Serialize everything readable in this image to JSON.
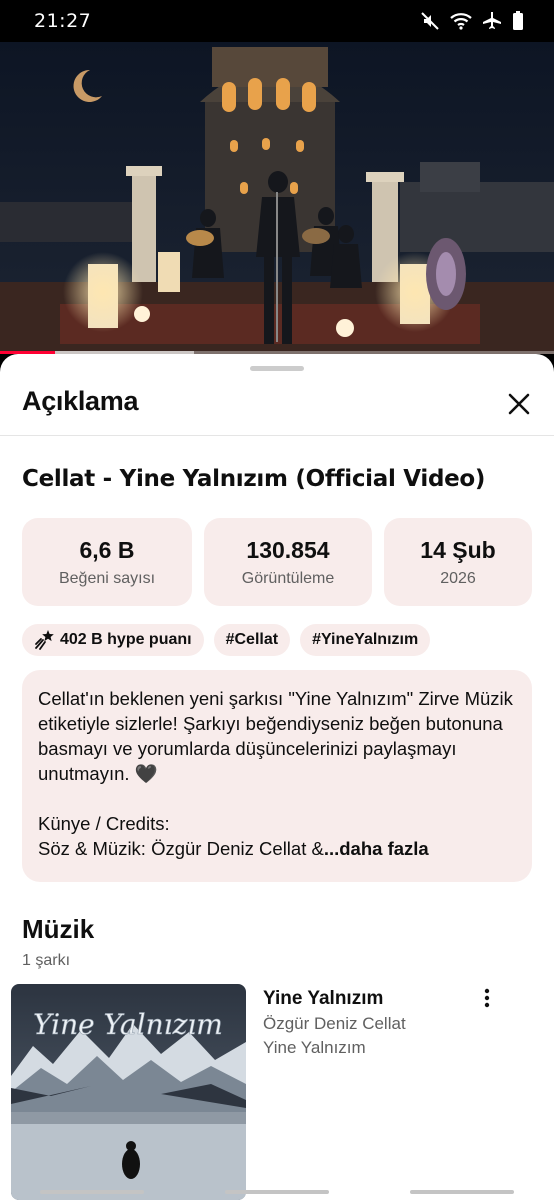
{
  "status_bar": {
    "time": "21:27",
    "icons": [
      "mute-icon",
      "wifi-icon",
      "airplane-icon",
      "battery-icon"
    ]
  },
  "video": {
    "progress_fraction": 0.1,
    "buffer_fraction": 0.35,
    "accent_color": "#ff0033"
  },
  "sheet": {
    "title": "Açıklama",
    "close_icon": "close-icon"
  },
  "details": {
    "video_title": "Cellat - Yine Yalnızım (Official Video)",
    "stats": [
      {
        "value": "6,6 B",
        "label": "Beğeni sayısı"
      },
      {
        "value": "130.854",
        "label": "Görüntüleme"
      },
      {
        "value": "14 Şub",
        "label": "2026"
      }
    ],
    "chips": [
      {
        "label": "402 B hype puanı",
        "icon": "hype-icon"
      },
      {
        "label": "#Cellat"
      },
      {
        "label": "#YineYalnızım"
      }
    ],
    "description": "Cellat'ın beklenen yeni şarkısı \"Yine Yalnızım\" Zirve Müzik etiketiyle sizlerle! Şarkıyı beğendiyseniz beğen butonuna basmayı ve yorumlarda düşüncelerinizi paylaşmayı unutmayın. 🖤\n\nKünye / Credits:\nSöz & Müzik: Özgür Deniz Cellat &",
    "more_label": "...daha fazla"
  },
  "music": {
    "heading": "Müzik",
    "count": "1 şarkı",
    "track": {
      "thumb_text": "Yine Yalnızım",
      "title": "Yine Yalnızım",
      "artist": "Özgür Deniz Cellat",
      "album": "Yine Yalnızım",
      "menu_icon": "more-vert-icon"
    }
  },
  "colors": {
    "card_bg": "#f8eceb",
    "secondary_text": "#606060"
  }
}
